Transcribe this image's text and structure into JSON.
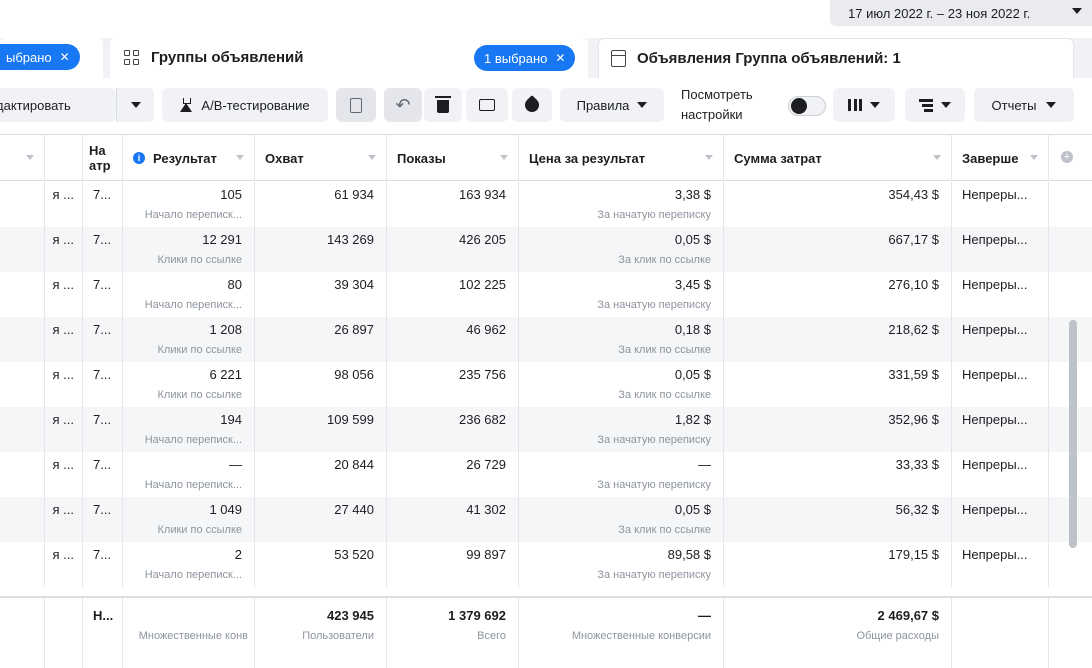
{
  "date_range": "17 июл 2022 г. – 23 ноя 2022 г.",
  "tabs": {
    "campaigns_selected": "ыбрано",
    "adsets_title": "Группы объявлений",
    "adsets_selected": "1 выбрано",
    "ads_title": "Объявления Группа объявлений: 1",
    "close_symbol": "✕"
  },
  "toolbar": {
    "edit_label": "дактировать",
    "ab_label": "A/B-тестирование",
    "undo_symbol": "↶",
    "rules_label": "Правила",
    "view_settings_label": "Посмотреть настройки",
    "reports_label": "Отчеты",
    "icons": [
      "flask-icon",
      "clipboard-icon",
      "undo-icon",
      "trash-icon",
      "preview-icon",
      "tag-icon",
      "columns-icon",
      "breakdown-icon"
    ]
  },
  "table": {
    "headers": {
      "attr": "На атр",
      "result": "Результат",
      "reach": "Охват",
      "impressions": "Показы",
      "cost_per_result": "Цена за результат",
      "amount_spent": "Сумма затрат",
      "ends": "Заверше"
    },
    "info_symbol": "i",
    "plus_symbol": "+",
    "rows": [
      {
        "c1": "я ...",
        "c2": "7...",
        "result": "105",
        "result_sub": "Начало переписк...",
        "reach": "61 934",
        "impressions": "163 934",
        "cpr": "3,38 $",
        "cpr_sub": "За начатую переписку",
        "spent": "354,43 $",
        "ends": "Непреры..."
      },
      {
        "c1": "я ...",
        "c2": "7...",
        "result": "12 291",
        "result_sub": "Клики по ссылке",
        "reach": "143 269",
        "impressions": "426 205",
        "cpr": "0,05 $",
        "cpr_sub": "За клик по ссылке",
        "spent": "667,17 $",
        "ends": "Непреры..."
      },
      {
        "c1": "я ...",
        "c2": "7...",
        "result": "80",
        "result_sub": "Начало переписк...",
        "reach": "39 304",
        "impressions": "102 225",
        "cpr": "3,45 $",
        "cpr_sub": "За начатую переписку",
        "spent": "276,10 $",
        "ends": "Непреры..."
      },
      {
        "c1": "я ...",
        "c2": "7...",
        "result": "1 208",
        "result_sub": "Клики по ссылке",
        "reach": "26 897",
        "impressions": "46 962",
        "cpr": "0,18 $",
        "cpr_sub": "За клик по ссылке",
        "spent": "218,62 $",
        "ends": "Непреры..."
      },
      {
        "c1": "я ...",
        "c2": "7...",
        "result": "6 221",
        "result_sub": "Клики по ссылке",
        "reach": "98 056",
        "impressions": "235 756",
        "cpr": "0,05 $",
        "cpr_sub": "За клик по ссылке",
        "spent": "331,59 $",
        "ends": "Непреры..."
      },
      {
        "c1": "я ...",
        "c2": "7...",
        "result": "194",
        "result_sub": "Начало переписк...",
        "reach": "109 599",
        "impressions": "236 682",
        "cpr": "1,82 $",
        "cpr_sub": "За начатую переписку",
        "spent": "352,96 $",
        "ends": "Непреры..."
      },
      {
        "c1": "я ...",
        "c2": "7...",
        "result": "—",
        "result_sub": "Начало переписк...",
        "reach": "20 844",
        "impressions": "26 729",
        "cpr": "—",
        "cpr_sub": "За начатую переписку",
        "spent": "33,33 $",
        "ends": "Непреры..."
      },
      {
        "c1": "я ...",
        "c2": "7...",
        "result": "1 049",
        "result_sub": "Клики по ссылке",
        "reach": "27 440",
        "impressions": "41 302",
        "cpr": "0,05 $",
        "cpr_sub": "За клик по ссылке",
        "spent": "56,32 $",
        "ends": "Непреры..."
      },
      {
        "c1": "я ...",
        "c2": "7...",
        "result": "2",
        "result_sub": "Начало переписк...",
        "reach": "53 520",
        "impressions": "99 897",
        "cpr": "89,58 $",
        "cpr_sub": "За начатую переписку",
        "spent": "179,15 $",
        "ends": "Непреры..."
      }
    ],
    "totals": {
      "c2": "Н...",
      "result_sub": "Множественные конв",
      "reach": "423 945",
      "reach_sub": "Пользователи",
      "impressions": "1 379 692",
      "impressions_sub": "Всего",
      "cpr": "—",
      "cpr_sub": "Множественные конверсии",
      "spent": "2 469,67 $",
      "spent_sub": "Общие расходы"
    }
  },
  "colors": {
    "accent": "#1877f2",
    "muted_text": "#8d949e",
    "button_bg": "#f0f2f5"
  }
}
